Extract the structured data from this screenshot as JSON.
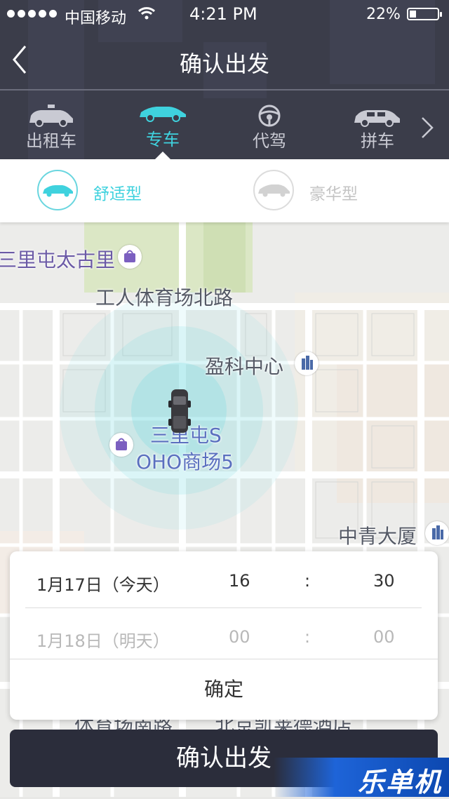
{
  "status_bar": {
    "carrier": "中国移动",
    "time": "4:21 PM",
    "battery": "22%"
  },
  "nav": {
    "title": "确认出发"
  },
  "tabs": [
    {
      "label": "出租车",
      "icon": "taxi-icon"
    },
    {
      "label": "专车",
      "icon": "car-icon",
      "active": true
    },
    {
      "label": "代驾",
      "icon": "steering-wheel-icon"
    },
    {
      "label": "拼车",
      "icon": "carpool-icon"
    }
  ],
  "car_types": [
    {
      "label": "舒适型",
      "selected": true
    },
    {
      "label": "豪华型",
      "selected": false
    }
  ],
  "map": {
    "labels": {
      "taikoo": "三里屯太古里",
      "gongti_north": "工人体育场北路",
      "yingke": "盈科中心",
      "soho_line1": "三里屯S",
      "soho_line2": "OHO商场5",
      "zhongqing": "中青大厦",
      "tiyuchang_south": "体育场南路",
      "kempinski": "北京凯莱德酒店"
    }
  },
  "picker": {
    "rows": [
      {
        "date": "1月17日（今天）",
        "hour": "16",
        "sep": ":",
        "minute": "30"
      },
      {
        "date": "1月18日（明天）",
        "hour": "00",
        "sep": ":",
        "minute": "00"
      }
    ],
    "ok_label": "确定"
  },
  "confirm_label": "确认出发",
  "watermark": "乐单机",
  "colors": {
    "accent": "#3fd2de",
    "header_bg": "#3b3d4a",
    "button_bg": "#2b2d3b"
  }
}
